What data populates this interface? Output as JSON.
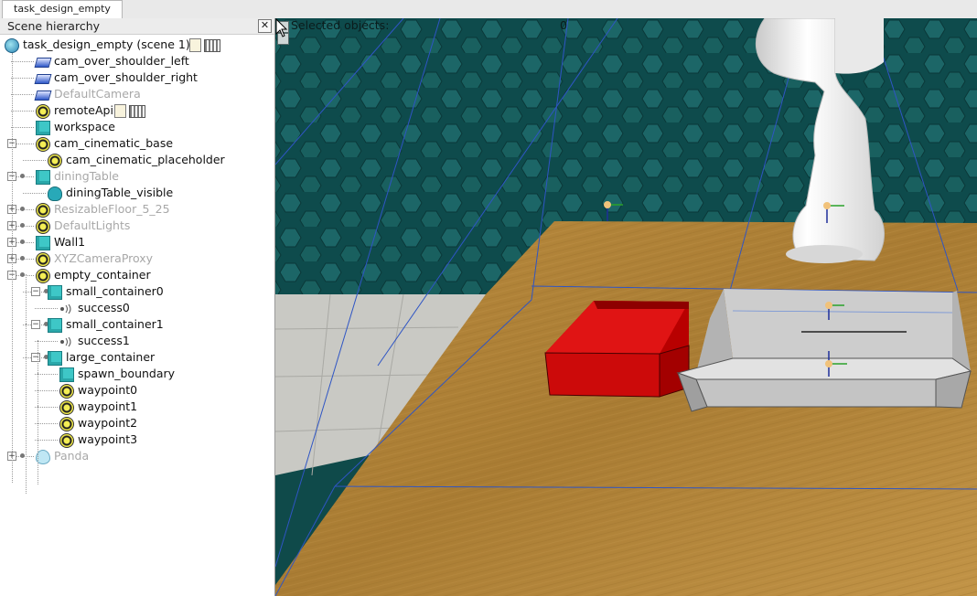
{
  "tab": {
    "label": "task_design_empty"
  },
  "hierarchy": {
    "title": "Scene hierarchy",
    "close_glyph": "✕",
    "root": {
      "label": "task_design_empty (scene 1)",
      "icon": "scene-globe-icon"
    },
    "items": [
      {
        "label": "cam_over_shoulder_left",
        "icon": "camera-icon",
        "dim": false
      },
      {
        "label": "cam_over_shoulder_right",
        "icon": "camera-icon",
        "dim": false
      },
      {
        "label": "DefaultCamera",
        "icon": "camera-icon",
        "dim": true
      },
      {
        "label": "remoteApi",
        "icon": "dummy-icon",
        "dim": false
      },
      {
        "label": "workspace",
        "icon": "cuboid-icon",
        "dim": false
      },
      {
        "label": "cam_cinematic_base",
        "icon": "dummy-icon",
        "dim": false
      },
      {
        "label": "cam_cinematic_placeholder",
        "icon": "dummy-icon",
        "dim": false
      },
      {
        "label": "diningTable",
        "icon": "cuboid-icon",
        "dim": true
      },
      {
        "label": "diningTable_visible",
        "icon": "shape-icon",
        "dim": false
      },
      {
        "label": "ResizableFloor_5_25",
        "icon": "dummy-icon",
        "dim": true
      },
      {
        "label": "DefaultLights",
        "icon": "dummy-icon",
        "dim": true
      },
      {
        "label": "Wall1",
        "icon": "cuboid-icon",
        "dim": false
      },
      {
        "label": "XYZCameraProxy",
        "icon": "dummy-icon",
        "dim": true
      },
      {
        "label": "empty_container",
        "icon": "dummy-icon",
        "dim": false
      },
      {
        "label": "small_container0",
        "icon": "cuboid-icon",
        "dim": false
      },
      {
        "label": "success0",
        "icon": "proximity-sensor-icon",
        "dim": false
      },
      {
        "label": "small_container1",
        "icon": "cuboid-icon",
        "dim": false
      },
      {
        "label": "success1",
        "icon": "proximity-sensor-icon",
        "dim": false
      },
      {
        "label": "large_container",
        "icon": "cuboid-icon",
        "dim": false
      },
      {
        "label": "spawn_boundary",
        "icon": "cuboid-icon",
        "dim": false
      },
      {
        "label": "waypoint0",
        "icon": "dummy-icon",
        "dim": false
      },
      {
        "label": "waypoint1",
        "icon": "dummy-icon",
        "dim": false
      },
      {
        "label": "waypoint2",
        "icon": "dummy-icon",
        "dim": false
      },
      {
        "label": "waypoint3",
        "icon": "dummy-icon",
        "dim": false
      },
      {
        "label": "Panda",
        "icon": "robot-drop-icon",
        "dim": true
      }
    ]
  },
  "viewport": {
    "selected_label": "Selected objects:",
    "selected_count": "0"
  },
  "colors": {
    "wall": "#0f4d4f",
    "hex_cell": "#1f6b6b",
    "floor": "#b8893d",
    "red_box": "#cc0a0a",
    "tray": "#cfcfcf",
    "robot": "#f4f4f4",
    "lines": "#2f55c4"
  }
}
